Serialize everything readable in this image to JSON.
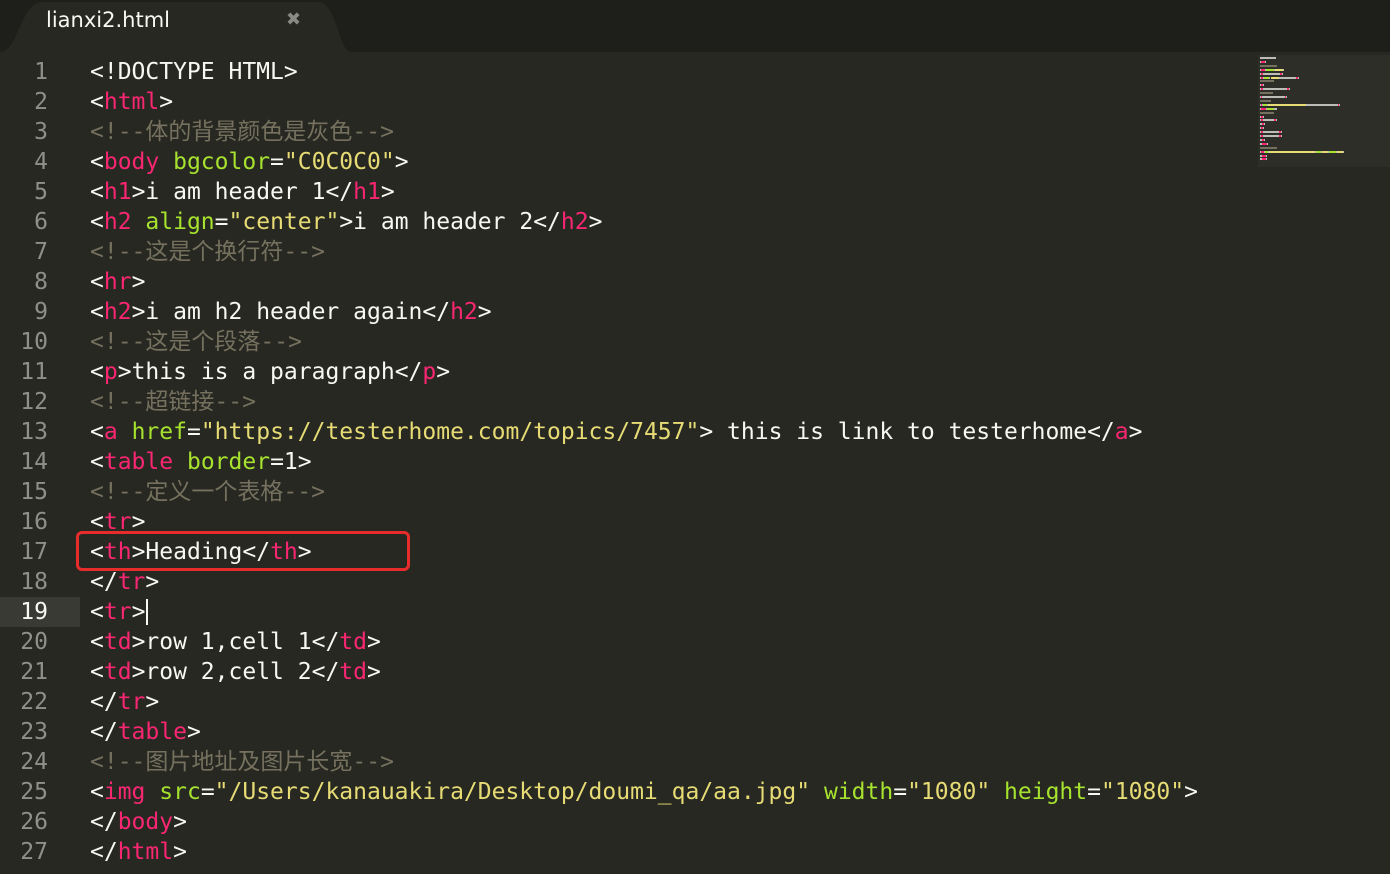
{
  "tab": {
    "title": "lianxi2.html",
    "close_glyph": "✖"
  },
  "active_line": 19,
  "lines": [
    {
      "n": "1",
      "tokens": [
        [
          "punct",
          "<!DOCTYPE HTML>"
        ]
      ]
    },
    {
      "n": "2",
      "tokens": [
        [
          "punct",
          "<"
        ],
        [
          "tag",
          "html"
        ],
        [
          "punct",
          ">"
        ]
      ]
    },
    {
      "n": "3",
      "tokens": [
        [
          "comment",
          "<!--体的背景颜色是灰色-->"
        ]
      ]
    },
    {
      "n": "4",
      "tokens": [
        [
          "punct",
          "<"
        ],
        [
          "tag",
          "body"
        ],
        [
          "text",
          " "
        ],
        [
          "attr",
          "bgcolor"
        ],
        [
          "punct",
          "="
        ],
        [
          "str",
          "\"C0C0C0\""
        ],
        [
          "punct",
          ">"
        ]
      ]
    },
    {
      "n": "5",
      "tokens": [
        [
          "punct",
          "<"
        ],
        [
          "tag",
          "h1"
        ],
        [
          "punct",
          ">"
        ],
        [
          "text",
          "i am header 1"
        ],
        [
          "punct",
          "</"
        ],
        [
          "tag",
          "h1"
        ],
        [
          "punct",
          ">"
        ]
      ]
    },
    {
      "n": "6",
      "tokens": [
        [
          "punct",
          "<"
        ],
        [
          "tag",
          "h2"
        ],
        [
          "text",
          " "
        ],
        [
          "attr",
          "align"
        ],
        [
          "punct",
          "="
        ],
        [
          "str",
          "\"center\""
        ],
        [
          "punct",
          ">"
        ],
        [
          "text",
          "i am header 2"
        ],
        [
          "punct",
          "</"
        ],
        [
          "tag",
          "h2"
        ],
        [
          "punct",
          ">"
        ]
      ]
    },
    {
      "n": "7",
      "tokens": [
        [
          "comment",
          "<!--这是个换行符-->"
        ]
      ]
    },
    {
      "n": "8",
      "tokens": [
        [
          "punct",
          "<"
        ],
        [
          "tag",
          "hr"
        ],
        [
          "punct",
          ">"
        ]
      ]
    },
    {
      "n": "9",
      "tokens": [
        [
          "punct",
          "<"
        ],
        [
          "tag",
          "h2"
        ],
        [
          "punct",
          ">"
        ],
        [
          "text",
          "i am h2 header again"
        ],
        [
          "punct",
          "</"
        ],
        [
          "tag",
          "h2"
        ],
        [
          "punct",
          ">"
        ]
      ]
    },
    {
      "n": "10",
      "tokens": [
        [
          "comment",
          "<!--这是个段落-->"
        ]
      ]
    },
    {
      "n": "11",
      "tokens": [
        [
          "punct",
          "<"
        ],
        [
          "tag",
          "p"
        ],
        [
          "punct",
          ">"
        ],
        [
          "text",
          "this is a paragraph"
        ],
        [
          "punct",
          "</"
        ],
        [
          "tag",
          "p"
        ],
        [
          "punct",
          ">"
        ]
      ]
    },
    {
      "n": "12",
      "tokens": [
        [
          "comment",
          "<!--超链接-->"
        ]
      ]
    },
    {
      "n": "13",
      "tokens": [
        [
          "punct",
          "<"
        ],
        [
          "tag",
          "a"
        ],
        [
          "text",
          " "
        ],
        [
          "attr",
          "href"
        ],
        [
          "punct",
          "="
        ],
        [
          "str",
          "\"https://testerhome.com/topics/7457\""
        ],
        [
          "punct",
          ">"
        ],
        [
          "text",
          " this is link to testerhome"
        ],
        [
          "punct",
          "</"
        ],
        [
          "tag",
          "a"
        ],
        [
          "punct",
          ">"
        ]
      ]
    },
    {
      "n": "14",
      "tokens": [
        [
          "punct",
          "<"
        ],
        [
          "tag",
          "table"
        ],
        [
          "text",
          " "
        ],
        [
          "attr",
          "border"
        ],
        [
          "punct",
          "=1>"
        ]
      ]
    },
    {
      "n": "15",
      "tokens": [
        [
          "comment",
          "<!--定义一个表格-->"
        ]
      ]
    },
    {
      "n": "16",
      "tokens": [
        [
          "punct",
          "<"
        ],
        [
          "tag",
          "tr"
        ],
        [
          "punct",
          ">"
        ]
      ]
    },
    {
      "n": "17",
      "tokens": [
        [
          "punct",
          "<"
        ],
        [
          "tag",
          "th"
        ],
        [
          "punct",
          ">"
        ],
        [
          "text",
          "Heading"
        ],
        [
          "punct",
          "</"
        ],
        [
          "tag",
          "th"
        ],
        [
          "punct",
          ">"
        ]
      ]
    },
    {
      "n": "18",
      "tokens": [
        [
          "punct",
          "</"
        ],
        [
          "tag",
          "tr"
        ],
        [
          "punct",
          ">"
        ]
      ]
    },
    {
      "n": "19",
      "tokens": [
        [
          "punct",
          "<"
        ],
        [
          "tag",
          "tr"
        ],
        [
          "punct",
          ">"
        ]
      ]
    },
    {
      "n": "20",
      "tokens": [
        [
          "punct",
          "<"
        ],
        [
          "tag",
          "td"
        ],
        [
          "punct",
          ">"
        ],
        [
          "text",
          "row 1,cell 1"
        ],
        [
          "punct",
          "</"
        ],
        [
          "tag",
          "td"
        ],
        [
          "punct",
          ">"
        ]
      ]
    },
    {
      "n": "21",
      "tokens": [
        [
          "punct",
          "<"
        ],
        [
          "tag",
          "td"
        ],
        [
          "punct",
          ">"
        ],
        [
          "text",
          "row 2,cell 2"
        ],
        [
          "punct",
          "</"
        ],
        [
          "tag",
          "td"
        ],
        [
          "punct",
          ">"
        ]
      ]
    },
    {
      "n": "22",
      "tokens": [
        [
          "punct",
          "</"
        ],
        [
          "tag",
          "tr"
        ],
        [
          "punct",
          ">"
        ]
      ]
    },
    {
      "n": "23",
      "tokens": [
        [
          "punct",
          "</"
        ],
        [
          "tag",
          "table"
        ],
        [
          "punct",
          ">"
        ]
      ]
    },
    {
      "n": "24",
      "tokens": [
        [
          "comment",
          "<!--图片地址及图片长宽-->"
        ]
      ]
    },
    {
      "n": "25",
      "tokens": [
        [
          "punct",
          "<"
        ],
        [
          "tag",
          "img"
        ],
        [
          "text",
          " "
        ],
        [
          "attr",
          "src"
        ],
        [
          "punct",
          "="
        ],
        [
          "str",
          "\"/Users/kanauakira/Desktop/doumi_qa/aa.jpg\""
        ],
        [
          "text",
          " "
        ],
        [
          "attr",
          "width"
        ],
        [
          "punct",
          "="
        ],
        [
          "str",
          "\"1080\""
        ],
        [
          "text",
          " "
        ],
        [
          "attr",
          "height"
        ],
        [
          "punct",
          "="
        ],
        [
          "str",
          "\"1080\""
        ],
        [
          "punct",
          ">"
        ]
      ]
    },
    {
      "n": "26",
      "tokens": [
        [
          "punct",
          "</"
        ],
        [
          "tag",
          "body"
        ],
        [
          "punct",
          ">"
        ]
      ]
    },
    {
      "n": "27",
      "tokens": [
        [
          "punct",
          "</"
        ],
        [
          "tag",
          "html"
        ],
        [
          "punct",
          ">"
        ]
      ]
    }
  ],
  "colors": {
    "background": "#272822",
    "tag": "#f92672",
    "attr": "#a6e22e",
    "string": "#e6db74",
    "comment": "#75715e",
    "text": "#f8f8f2",
    "annotation_box": "#e82c2c"
  }
}
